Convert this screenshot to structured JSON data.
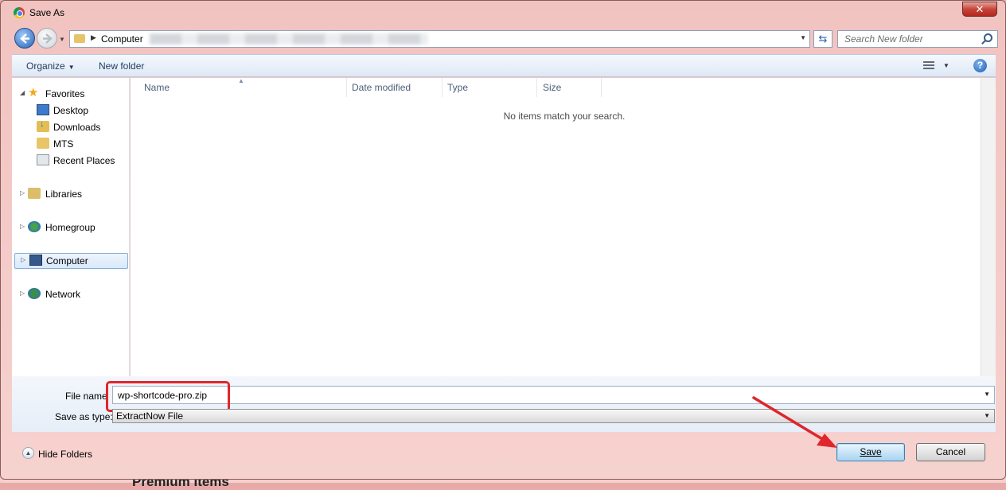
{
  "window": {
    "title": "Save As",
    "close_icon": "✕"
  },
  "address_bar": {
    "path_root": "Computer",
    "search_placeholder": "Search New folder"
  },
  "toolbar": {
    "organize_label": "Organize",
    "new_folder_label": "New folder",
    "help_label": "?"
  },
  "navigation": {
    "favorites": {
      "label": "Favorites",
      "items": [
        "Desktop",
        "Downloads",
        "MTS",
        "Recent Places"
      ]
    },
    "libraries": "Libraries",
    "homegroup": "Homegroup",
    "computer": "Computer",
    "network": "Network"
  },
  "file_list": {
    "columns": [
      "Name",
      "Date modified",
      "Type",
      "Size"
    ],
    "empty_message": "No items match your search."
  },
  "form": {
    "file_name_label": "File name",
    "file_name_value": "wp-shortcode-pro.zip",
    "save_type_label": "Save as type:",
    "save_type_value": "ExtractNow File"
  },
  "footer": {
    "hide_folders_label": "Hide Folders",
    "save_label": "Save",
    "cancel_label": "Cancel"
  },
  "background": {
    "partial_heading": "Premium Items"
  },
  "colors": {
    "highlight": "#e0262c",
    "accent": "#2765b7"
  }
}
